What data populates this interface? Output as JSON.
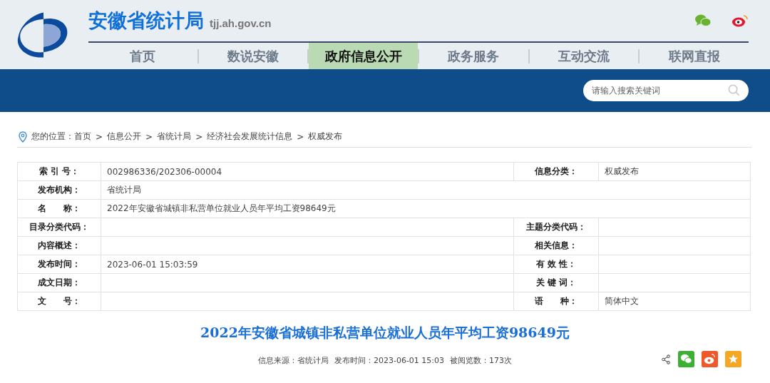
{
  "site": {
    "title": "安徽省统计局",
    "domain": "tjj.ah.gov.cn"
  },
  "nav": [
    {
      "label": "首页",
      "selected": false
    },
    {
      "label": "数说安徽",
      "selected": false
    },
    {
      "label": "政府信息公开",
      "selected": true
    },
    {
      "label": "政务服务",
      "selected": false
    },
    {
      "label": "互动交流",
      "selected": false
    },
    {
      "label": "联网直报",
      "selected": false
    }
  ],
  "search": {
    "placeholder": "请输入搜索关键词"
  },
  "breadcrumb": {
    "prefix": "您的位置：",
    "items": [
      "首页",
      "信息公开",
      "省统计局",
      "经济社会发展统计信息",
      "权威发布"
    ],
    "separator": ">"
  },
  "info_table": [
    {
      "kind": "pair",
      "label": "索 引 号：",
      "value": "002986336/202306-00004",
      "label2": "信息分类：",
      "value2": "权威发布"
    },
    {
      "kind": "single",
      "label": "发布机构：",
      "value": "省统计局"
    },
    {
      "kind": "single",
      "label": "名　　称：",
      "value": "2022年安徽省城镇非私营单位就业人员年平均工资98649元"
    },
    {
      "kind": "pair",
      "label": "目录分类代码：",
      "label2": "主题分类代码："
    },
    {
      "kind": "pair",
      "label": "内容概述：",
      "label2": "相关信息："
    },
    {
      "kind": "pair",
      "label": "发布时间：",
      "value": "2023-06-01 15:03:59",
      "label2": "有 效 性："
    },
    {
      "kind": "pair",
      "label": "成文日期：",
      "label2": "关 键 词："
    },
    {
      "kind": "pair",
      "label": "文　　号：",
      "label2": "语　　种：",
      "value2": "简体中文"
    }
  ],
  "article": {
    "title": "2022年安徽省城镇非私营单位就业人员年平均工资98649元",
    "meta": [
      "信息来源：省统计局",
      "发布时间：2023-06-01 15:03",
      "被阅览数：173次"
    ]
  }
}
